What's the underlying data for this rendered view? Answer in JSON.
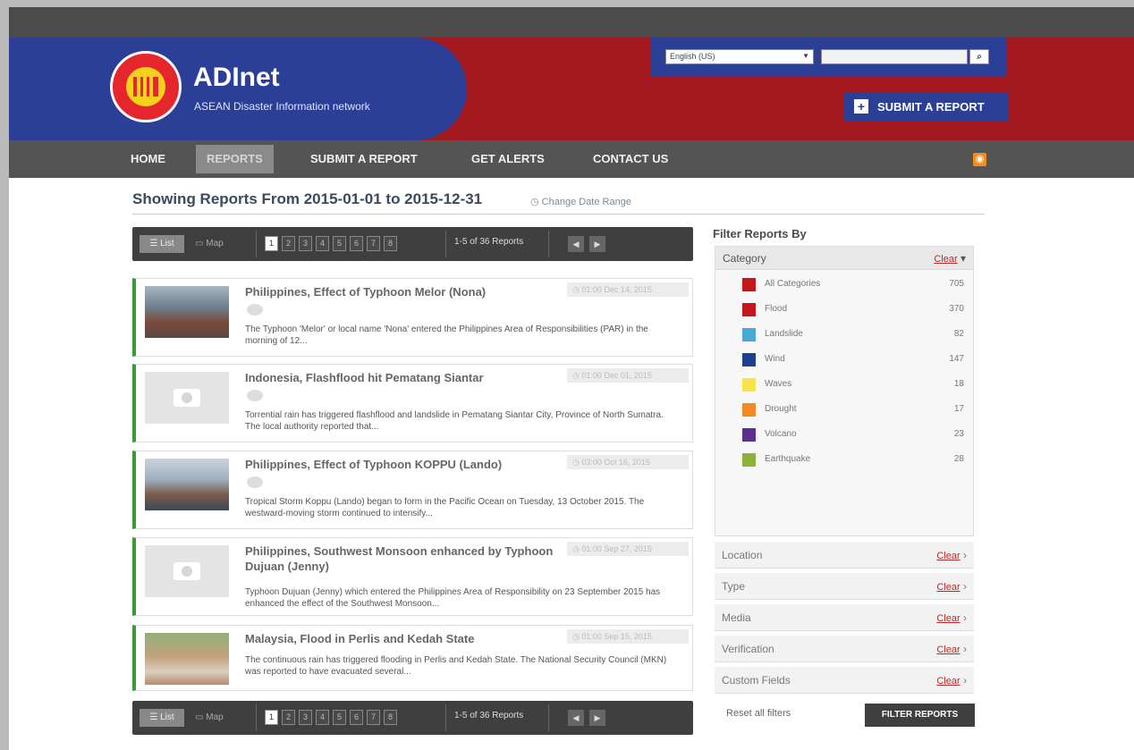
{
  "site": {
    "name": "ADInet",
    "tagline": "ASEAN Disaster Information network"
  },
  "header": {
    "language": "English (US)",
    "search_placeholder": "",
    "submit_label": "SUBMIT A REPORT"
  },
  "nav": {
    "items": [
      {
        "label": "HOME"
      },
      {
        "label": "REPORTS"
      },
      {
        "label": "SUBMIT A REPORT"
      },
      {
        "label": "GET ALERTS"
      },
      {
        "label": "CONTACT US"
      }
    ],
    "active": "REPORTS"
  },
  "page": {
    "heading": "Showing Reports From 2015-01-01 to 2015-12-31",
    "change_range": "Change Date Range"
  },
  "toolbar": {
    "list": "List",
    "map": "Map",
    "pages": [
      "1",
      "2",
      "3",
      "4",
      "5",
      "6",
      "7",
      "8"
    ],
    "current_page": "1",
    "count": "1-5 of 36 Reports"
  },
  "reports": [
    {
      "title": "Philippines, Effect of Typhoon Melor (Nona)",
      "date": "01:00 Dec 14, 2015",
      "desc": "The Typhoon 'Melor' or local name 'Nona' entered the Philippines Area of Responsibilities (PAR) in the morning of 12...",
      "thumb": "photo"
    },
    {
      "title": "Indonesia, Flashflood hit Pematang Siantar",
      "date": "01:00 Dec 01, 2015",
      "desc": "Torrential rain has triggered flashflood and landslide in Pematang Siantar City, Province of North Sumatra. The local authority reported that...",
      "thumb": "blank"
    },
    {
      "title": "Philippines, Effect of Typhoon KOPPU (Lando)",
      "date": "03:00 Oct 16, 2015",
      "desc": "Tropical Storm Koppu (Lando) began to form in the Pacific Ocean on Tuesday, 13 October 2015. The westward-moving storm continued to intensify...",
      "thumb": "photo"
    },
    {
      "title": "Philippines, Southwest Monsoon enhanced by Typhoon Dujuan (Jenny)",
      "date": "01:00 Sep 27, 2015",
      "desc": "Typhoon Dujuan (Jenny) which entered the Philippines Area of Responsibility on 23 September 2015 has enhanced the effect of the Southwest Monsoon...",
      "thumb": "blank"
    },
    {
      "title": "Malaysia, Flood in Perlis and Kedah State",
      "date": "01:00 Sep 15, 2015",
      "desc": "The continuous rain has triggered flooding in Perlis and Kedah State. The National Security Council (MKN) was reported to have evacuated several...",
      "thumb": "photo"
    }
  ],
  "filters": {
    "title": "Filter Reports By",
    "category_label": "Category",
    "clear": "Clear",
    "categories": [
      {
        "name": "All Categories",
        "count": "705",
        "color": "#c4161c"
      },
      {
        "name": "Flood",
        "count": "370",
        "color": "#c4161c"
      },
      {
        "name": "Landslide",
        "count": "82",
        "color": "#4aa8d8"
      },
      {
        "name": "Wind",
        "count": "147",
        "color": "#1c3f8f"
      },
      {
        "name": "Waves",
        "count": "18",
        "color": "#f6e44a"
      },
      {
        "name": "Drought",
        "count": "17",
        "color": "#f08a24"
      },
      {
        "name": "Volcano",
        "count": "23",
        "color": "#5a2f8f"
      },
      {
        "name": "Earthquake",
        "count": "28",
        "color": "#8db23a"
      }
    ],
    "sections": [
      {
        "label": "Location"
      },
      {
        "label": "Type"
      },
      {
        "label": "Media"
      },
      {
        "label": "Verification"
      },
      {
        "label": "Custom Fields"
      }
    ],
    "reset": "Reset all filters",
    "apply": "FILTER REPORTS"
  }
}
